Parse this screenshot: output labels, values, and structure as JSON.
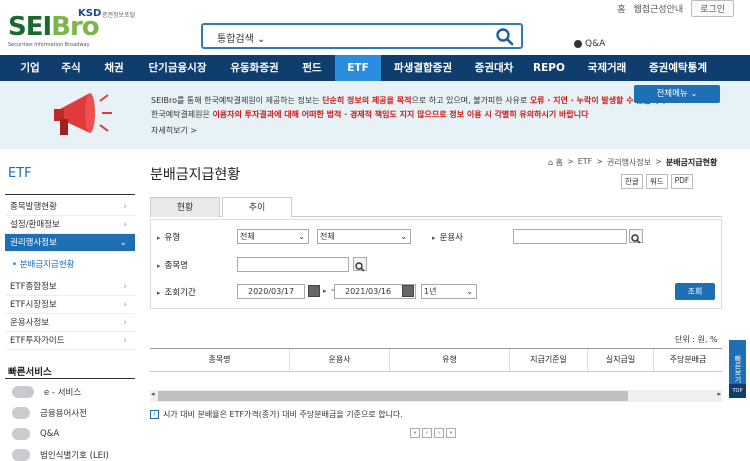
{
  "header": {
    "logo_text_a": "SEI",
    "logo_text_b": "Bro",
    "ksd": "KSD",
    "ksd_sub": "증권정보포털",
    "logo_tag": "Securities Information Broadway",
    "top_links": [
      "홈",
      "웹접근성안내"
    ],
    "login": "로그인",
    "search_select": "통합검색",
    "qna": "Q&A"
  },
  "nav": [
    "기업",
    "주식",
    "채권",
    "단기금융시장",
    "유동화증권",
    "펀드",
    "ETF",
    "파생결합증권",
    "증권대차",
    "REPO",
    "국제거래",
    "증권예탁통계"
  ],
  "nav_active": "ETF",
  "banner": {
    "line1_a": "SEIBro를 통해 한국예탁결제원이 제공하는 정보는 ",
    "line1_red1": "단순히 정보의 제공을 목적",
    "line1_b": "으로 하고 있으며, 불가피한 사유로 ",
    "line1_red2": "오류 · 지연 · 누락이 발생할 수 있습니다.",
    "line2_a": "한국예탁결제원은 ",
    "line2_red": "이용자의 투자결과에 대해 어떠한 법적 · 경제적 책임도 지지 않으므로 정보 이용 시 각별히 유의하시기 바랍니다",
    "more": "자세히보기 >",
    "all_menu": "전체메뉴 ⌄"
  },
  "sidebar": {
    "title": "ETF",
    "items": [
      {
        "label": "종목발행현황"
      },
      {
        "label": "설정/환매정보"
      },
      {
        "label": "권리행사정보",
        "active": true
      },
      {
        "label": "ETF종합정보"
      },
      {
        "label": "ETF시장정보"
      },
      {
        "label": "운용사정보"
      },
      {
        "label": "ETF투자가이드"
      }
    ],
    "sub_item": "• 분배금지급현황",
    "quick_title": "빠른서비스",
    "quick": [
      "e - 서비스",
      "금융용어사전",
      "Q&A",
      "법인식별기호 (LEI)"
    ]
  },
  "main": {
    "title": "분배금지급현황",
    "breadcrumb": [
      "⌂ 홈",
      ">",
      "ETF",
      ">",
      "권리행사정보",
      ">"
    ],
    "breadcrumb_current": "분배금지급현황",
    "tools": [
      "한글",
      "워드",
      "PDF"
    ],
    "tabs": [
      "현황",
      "추이"
    ],
    "filter": {
      "type_label": "유형",
      "type_sel1": "전체",
      "type_sel2": "전체",
      "manager_label": "운용사",
      "item_label": "종목명",
      "period_label": "조회기간",
      "date_from": "2020/03/17",
      "tilde": "~",
      "date_to": "2021/03/16",
      "period_sel": "1년",
      "search_button": "조회"
    },
    "unit": "단위 : 원, %",
    "table_headers": [
      "종목명",
      "운용사",
      "유형",
      "지급기준일",
      "실지급일",
      "주당분배금"
    ],
    "note": "시가 대비 분배율은 ETF가격(종가) 대비 주당분배금을 기준으로 합니다.",
    "pager": [
      "«",
      "‹",
      "›",
      "»"
    ]
  },
  "float": {
    "side_button": "빠른보기",
    "top_button": "TOP"
  },
  "colors": {
    "nav": "#0e3d6e",
    "accent": "#2a8de0",
    "banner_bg": "#e6f2f5",
    "red": "#d01818"
  }
}
